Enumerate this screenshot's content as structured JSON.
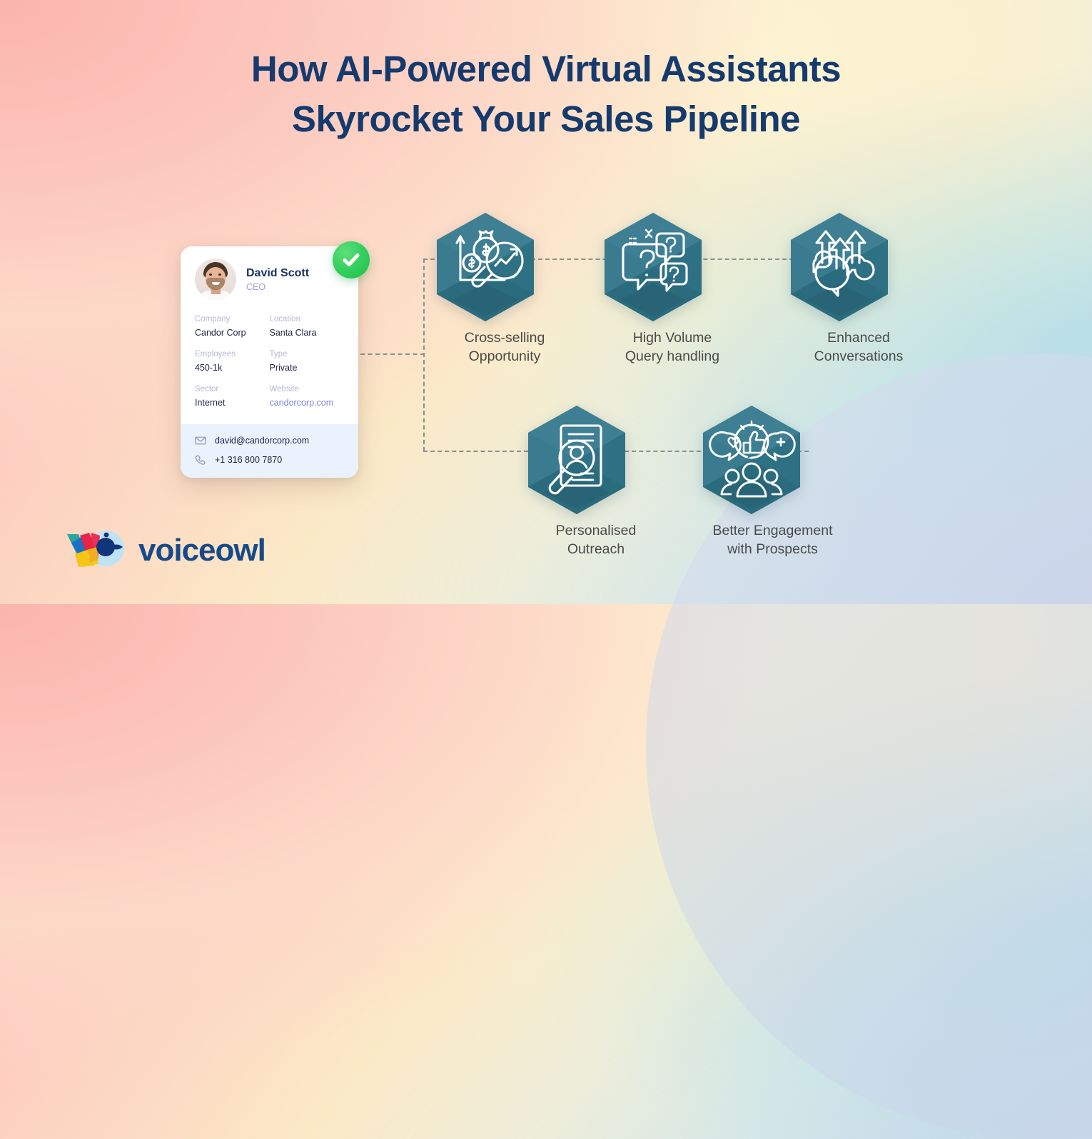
{
  "title": {
    "line1": "How AI-Powered Virtual Assistants",
    "line2": "Skyrocket Your Sales Pipeline",
    "color": "#153a6e"
  },
  "profile_card": {
    "name": "David Scott",
    "role": "CEO",
    "verified_badge": "check-badge",
    "fields": [
      {
        "label": "Company",
        "value": "Candor Corp",
        "is_link": false
      },
      {
        "label": "Location",
        "value": "Santa Clara",
        "is_link": false
      },
      {
        "label": "Employees",
        "value": "450-1k",
        "is_link": false
      },
      {
        "label": "Type",
        "value": "Private",
        "is_link": false
      },
      {
        "label": "Sector",
        "value": "Internet",
        "is_link": false
      },
      {
        "label": "Website",
        "value": "candorcorp.com",
        "is_link": true
      }
    ],
    "contacts": [
      {
        "icon": "envelope-icon",
        "value": "david@candorcorp.com"
      },
      {
        "icon": "phone-icon",
        "value": "+1 316 800 7870"
      }
    ],
    "colors": {
      "label": "#b5b8d6",
      "value": "#1c2340",
      "link": "#7b86dd",
      "contact_bg": "#e9f2fd",
      "badge_green": "#2ecc5b"
    }
  },
  "nodes": [
    {
      "id": "cross-selling",
      "label": "Cross-selling\nOpportunity",
      "icon": "money-bag-growth-chart-icon"
    },
    {
      "id": "high-volume-query",
      "label": "High Volume\nQuery handling",
      "icon": "question-speech-bubbles-icon"
    },
    {
      "id": "enhanced-conversations",
      "label": "Enhanced\nConversations",
      "icon": "speech-bubbles-arrows-up-icon"
    },
    {
      "id": "personalised-outreach",
      "label": "Personalised\nOutreach",
      "icon": "document-magnifier-person-icon"
    },
    {
      "id": "better-engagement",
      "label": "Better Engagement\nwith Prospects",
      "icon": "people-reactions-icon"
    }
  ],
  "hex_colors": {
    "light": "#3f7f94",
    "mid": "#35788c",
    "dark": "#2b6b7e",
    "darkest": "#285f70",
    "icon_stroke": "#ffffff"
  },
  "logo": {
    "wordmark": "voiceowl",
    "mark": "voiceowl-vo-mark",
    "color": "#164a8a",
    "mark_colors": [
      "#2aa79b",
      "#1b6fc4",
      "#e8234a",
      "#f5c518",
      "#bfe3f5",
      "#10357a"
    ]
  },
  "connectors": {
    "style": "dashed",
    "color": "#8d8d8d"
  }
}
